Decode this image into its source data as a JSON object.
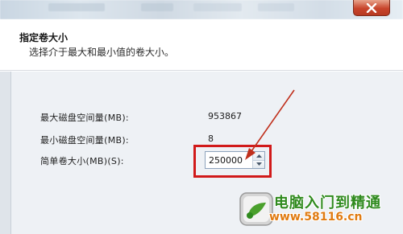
{
  "header": {
    "title": "指定卷大小",
    "subtitle": "选择介于最大和最小值的卷大小。"
  },
  "fields": [
    {
      "label": "最大磁盘空间量(MB):",
      "value": "953867"
    },
    {
      "label": "最小磁盘空间量(MB):",
      "value": "8"
    }
  ],
  "size_field": {
    "label": "简单卷大小(MB)(S):",
    "value": "250000"
  },
  "watermark": {
    "title": "电脑入门到精通",
    "url": "www.58116.cn"
  },
  "colors": {
    "highlight": "#d11a1a",
    "watermark_title": "#2f8a1e",
    "watermark_url": "#e07b12"
  },
  "icons": {
    "close": "close-icon",
    "spin_up": "spin-up-icon",
    "spin_down": "spin-down-icon",
    "logo": "watermark-logo-icon"
  }
}
